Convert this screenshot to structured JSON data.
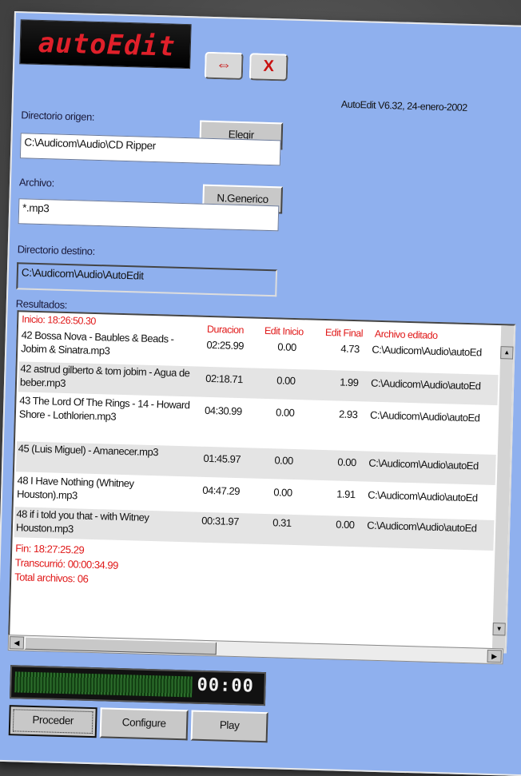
{
  "app": {
    "logo_text": "autoEdit",
    "version": "AutoEdit V6.32, 24-enero-2002",
    "toolbar": {
      "resize_label": "⇔",
      "close_label": "X"
    }
  },
  "form": {
    "source_dir": {
      "label": "Directorio origen:",
      "value": "C:\\Audicom\\Audio\\CD Ripper",
      "button": "Elegir"
    },
    "file": {
      "label": "Archivo:",
      "value": "*.mp3",
      "button": "N.Generico"
    },
    "dest_dir": {
      "label": "Directorio destino:",
      "value": "C:\\Audicom\\Audio\\AutoEdit"
    }
  },
  "results": {
    "label": "Resultados:",
    "start": "Inicio: 18:26:50.30",
    "columns": [
      "Duracion",
      "Edit Inicio",
      "Edit Final",
      "Archivo editado"
    ],
    "rows": [
      {
        "name": "42 Bossa Nova - Baubles & Beads - Jobim & Sinatra.mp3",
        "duration": "02:25.99",
        "edit_start": "0.00",
        "edit_end": "4.73",
        "path": "C:\\Audicom\\Audio\\autoEd"
      },
      {
        "name": "42 astrud gilberto & tom jobim - Agua de beber.mp3",
        "duration": "02:18.71",
        "edit_start": "0.00",
        "edit_end": "1.99",
        "path": "C:\\Audicom\\Audio\\autoEd"
      },
      {
        "name": "43 The Lord Of The Rings - 14 - Howard Shore - Lothlorien.mp3",
        "duration": "04:30.99",
        "edit_start": "0.00",
        "edit_end": "2.93",
        "path": "C:\\Audicom\\Audio\\autoEd"
      },
      {
        "name": "45 (Luis Miguel) - Amanecer.mp3",
        "duration": "01:45.97",
        "edit_start": "0.00",
        "edit_end": "0.00",
        "path": "C:\\Audicom\\Audio\\autoEd"
      },
      {
        "name": "48 I Have Nothing (Whitney Houston).mp3",
        "duration": "04:47.29",
        "edit_start": "0.00",
        "edit_end": "1.91",
        "path": "C:\\Audicom\\Audio\\autoEd"
      },
      {
        "name": "48 if i told you that - with Witney Houston.mp3",
        "duration": "00:31.97",
        "edit_start": "0.31",
        "edit_end": "0.00",
        "path": "C:\\Audicom\\Audio\\autoEd"
      }
    ],
    "end": "Fin: 18:27:25.29",
    "elapsed": "Transcurrió: 00:00:34.99",
    "total": "Total archivos: 06"
  },
  "player": {
    "time": "00:00"
  },
  "buttons": {
    "proceed": "Proceder",
    "configure": "Configure",
    "play": "Play"
  },
  "colors": {
    "window_bg": "#8fb0ee",
    "accent_red": "#e01818",
    "logo_red": "#e0202a"
  }
}
